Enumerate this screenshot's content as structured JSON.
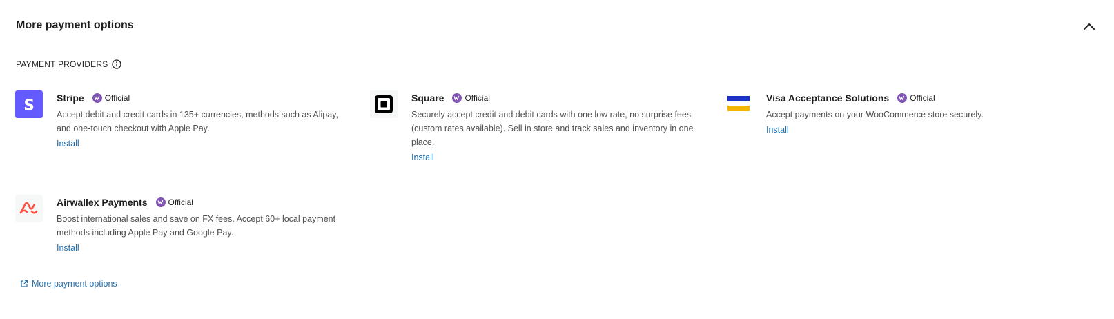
{
  "section": {
    "title": "More payment options",
    "collapse_icon": "chevron-up-icon"
  },
  "providers_label": "PAYMENT PROVIDERS",
  "providers": [
    {
      "name": "Stripe",
      "badge": "Official",
      "description": "Accept debit and credit cards in 135+ currencies, methods such as Alipay, and one-touch checkout with Apple Pay.",
      "action": "Install",
      "logo": "stripe-logo",
      "logo_color": "#635bff"
    },
    {
      "name": "Square",
      "badge": "Official",
      "description": "Securely accept credit and debit cards with one low rate, no surprise fees (custom rates available). Sell in store and track sales and inventory in one place.",
      "action": "Install",
      "logo": "square-logo",
      "logo_color": "#000000"
    },
    {
      "name": "Visa Acceptance Solutions",
      "badge": "Official",
      "description": "Accept payments on your WooCommerce store securely.",
      "action": "Install",
      "logo": "visa-acceptance-logo",
      "logo_colors": [
        "#1a33c7",
        "#f4b400"
      ]
    },
    {
      "name": "Airwallex Payments",
      "badge": "Official",
      "description": "Boost international sales and save on FX fees. Accept 60+ local payment methods including Apple Pay and Google Pay.",
      "action": "Install",
      "logo": "airwallex-logo",
      "logo_color": "#ff4f42"
    }
  ],
  "more_link": "More payment options",
  "colors": {
    "link": "#2271b1",
    "badge_purple": "#7f54b3",
    "text": "#1e1e1e",
    "muted_text": "#505050"
  }
}
